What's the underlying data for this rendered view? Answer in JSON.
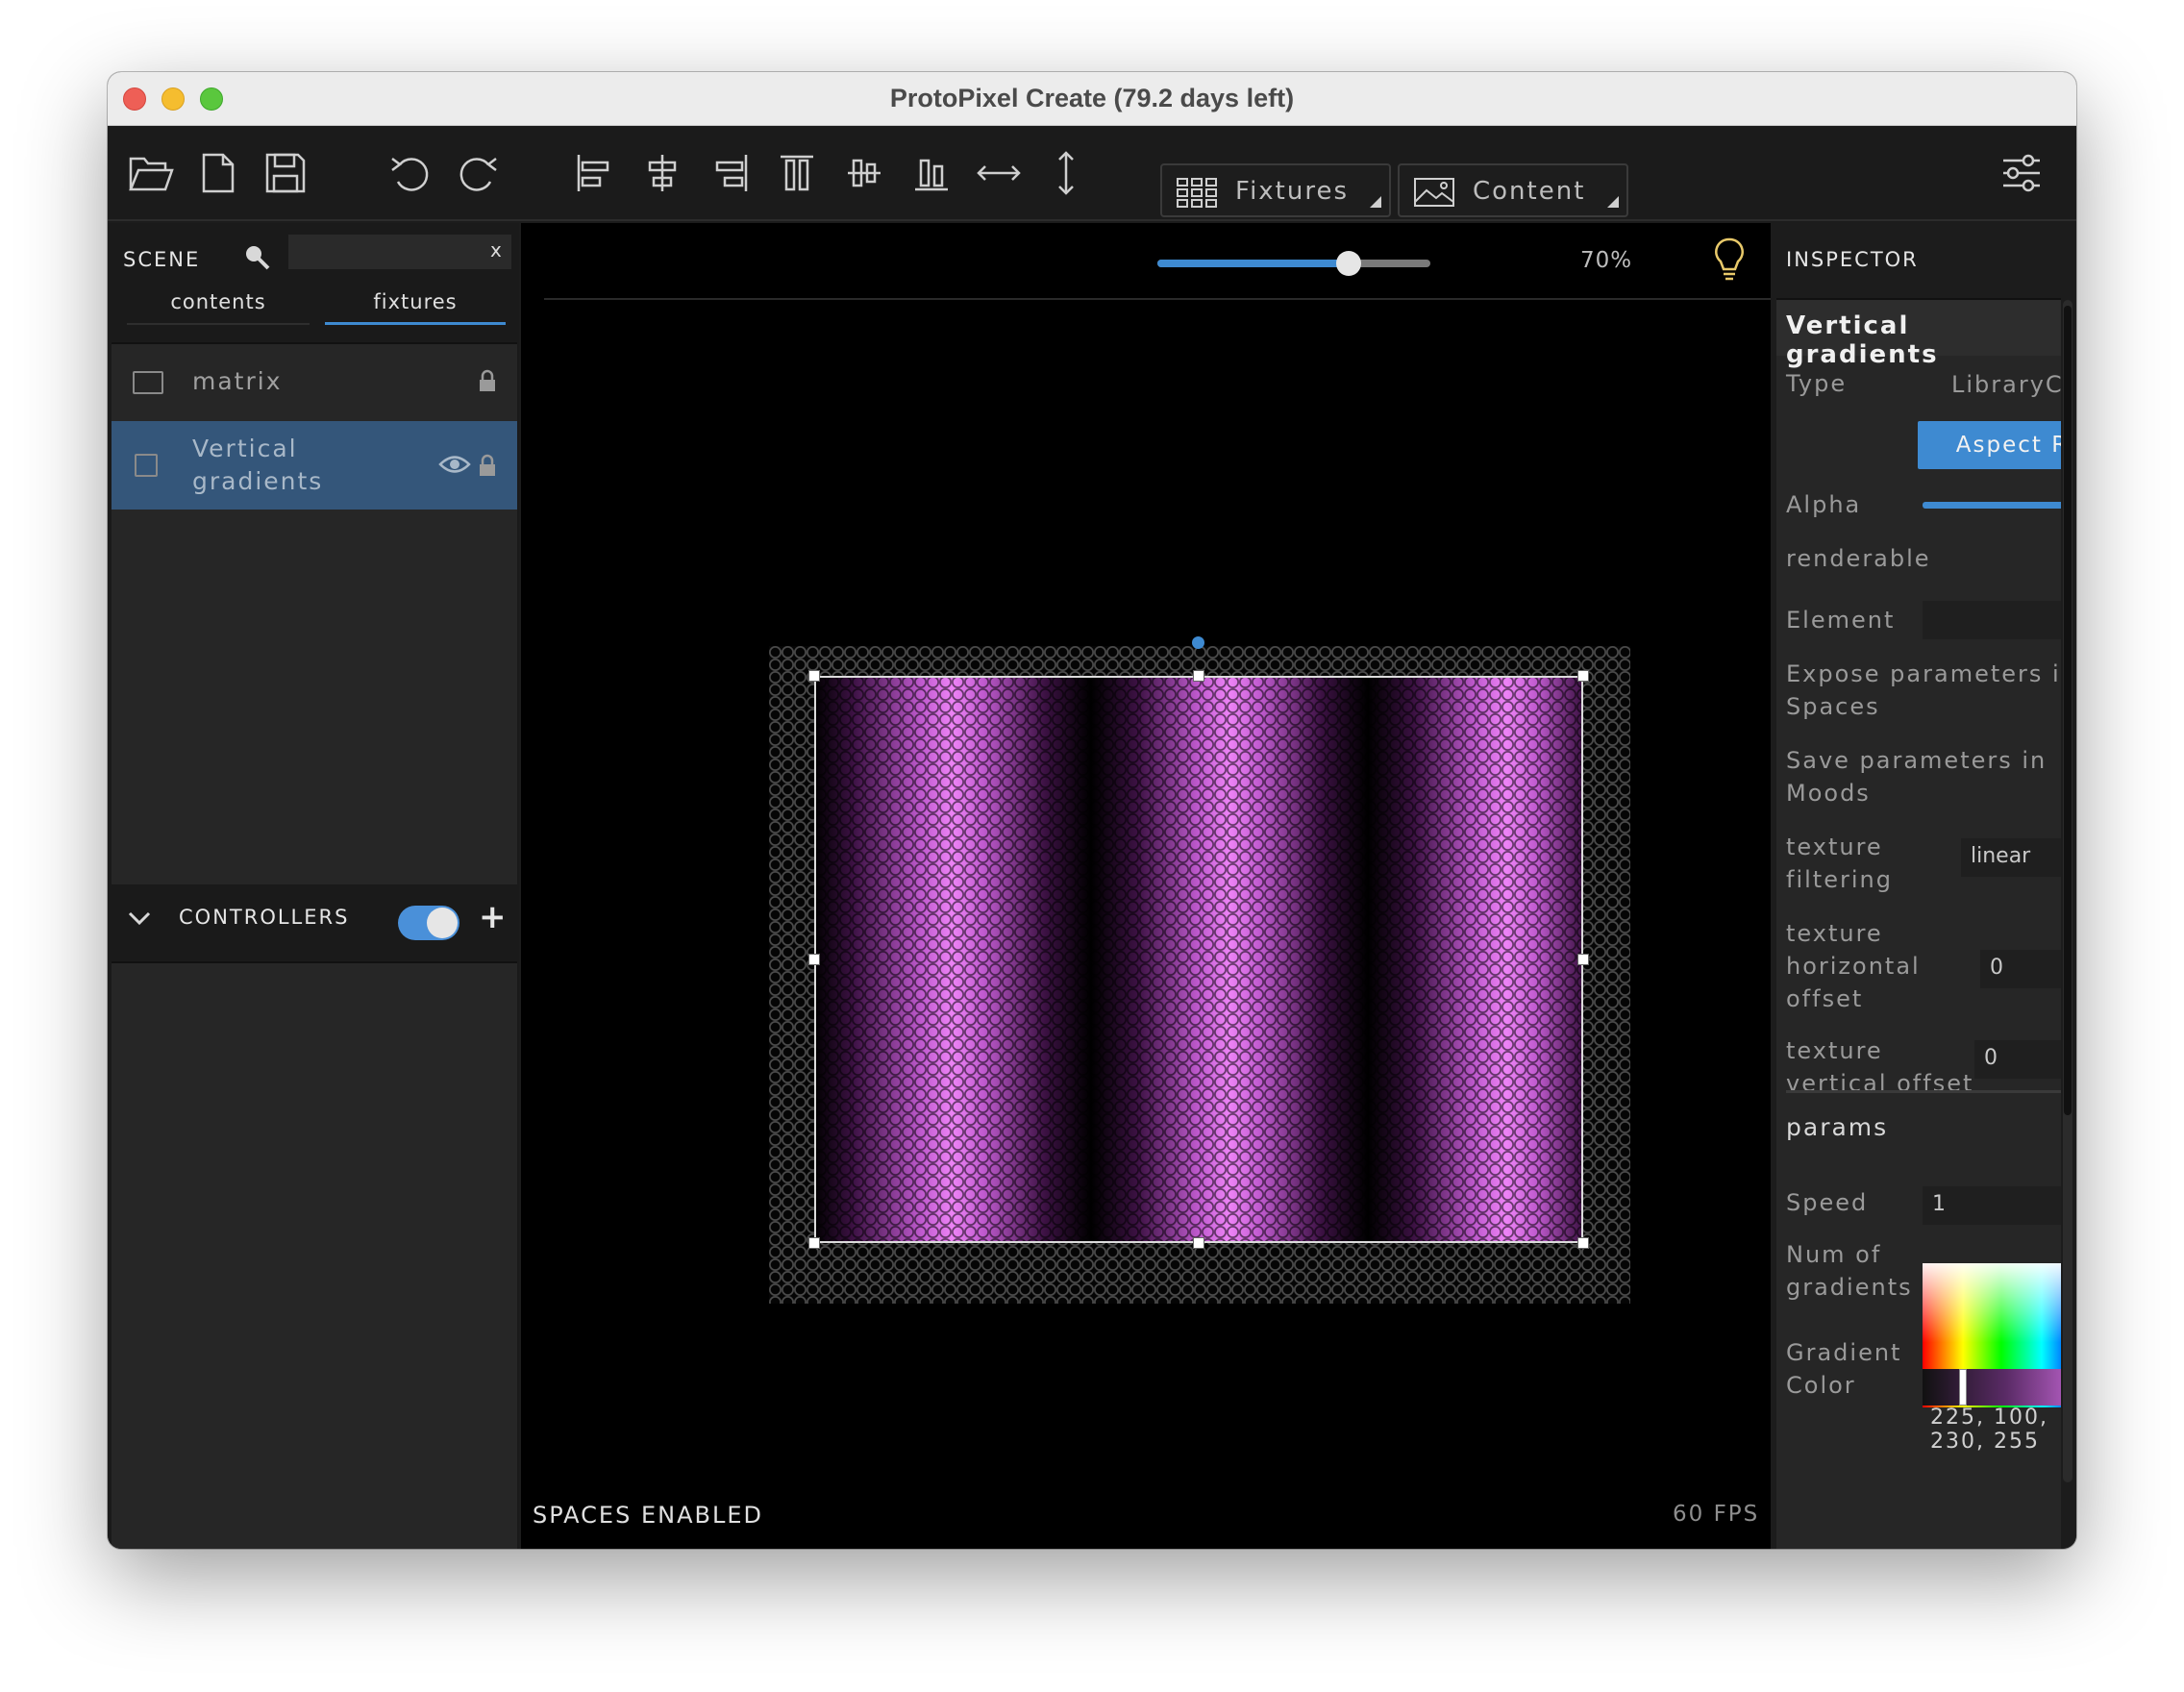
{
  "window": {
    "title": "ProtoPixel Create (79.2 days left)"
  },
  "toolbar": {
    "icons": [
      "open-folder-icon",
      "new-file-icon",
      "save-icon",
      "undo-icon",
      "redo-icon",
      "align-left-icon",
      "align-center-h-icon",
      "align-right-icon",
      "align-top-icon",
      "align-center-v-icon",
      "align-bottom-icon",
      "distribute-horizontal-icon",
      "distribute-vertical-icon",
      "settings-sliders-icon"
    ],
    "fixtures_label": "Fixtures",
    "content_label": "Content"
  },
  "scene": {
    "header": "SCENE",
    "search_value": "",
    "search_clear": "x",
    "tabs": [
      {
        "label": "contents",
        "active": false
      },
      {
        "label": "fixtures",
        "active": true
      }
    ],
    "items": [
      {
        "label": "matrix",
        "selected": false,
        "locked": true,
        "visible_icon": false
      },
      {
        "label": "Vertical gradients",
        "selected": true,
        "locked": true,
        "visible_icon": true
      }
    ]
  },
  "controllers": {
    "header": "CONTROLLERS",
    "enabled": true,
    "add_label": "+"
  },
  "canvas": {
    "zoom_percent": 70,
    "zoom_label": "70%",
    "status_left": "SPACES ENABLED",
    "status_right": "60 FPS"
  },
  "inspector": {
    "header": "INSPECTOR",
    "title": "Vertical gradients",
    "type_label": "Type",
    "type_value": "LibraryContent",
    "aspect_ratio_button": "Aspect Ratio",
    "alpha_label": "Alpha",
    "alpha_value": "100",
    "renderable_label": "renderable",
    "renderable": true,
    "element_label": "Element",
    "element_value": "",
    "expose_label": "Expose parameters in Spaces",
    "expose": false,
    "save_moods_label": "Save parameters in Moods",
    "save_moods": true,
    "texture_filtering_label": "texture filtering",
    "texture_filtering_value": "linear",
    "texture_h_offset_label": "texture horizontal offset",
    "texture_h_offset_value": "0",
    "texture_v_offset_label": "texture vertical offset",
    "texture_v_offset_value": "0",
    "params_header": "params",
    "speed_label": "Speed",
    "speed_value": "1",
    "num_gradients_label": "Num of gradients",
    "num_gradients_value": "3",
    "gradient_color_label": "Gradient Color",
    "gradient_color_values": "225, 100, 230, 255"
  },
  "colors": {
    "accent": "#3e8ad1",
    "selected_row": "#34567a",
    "gradient_peak": "#ed83f6",
    "panel_bg": "#262626",
    "canvas_bg": "#000000"
  }
}
